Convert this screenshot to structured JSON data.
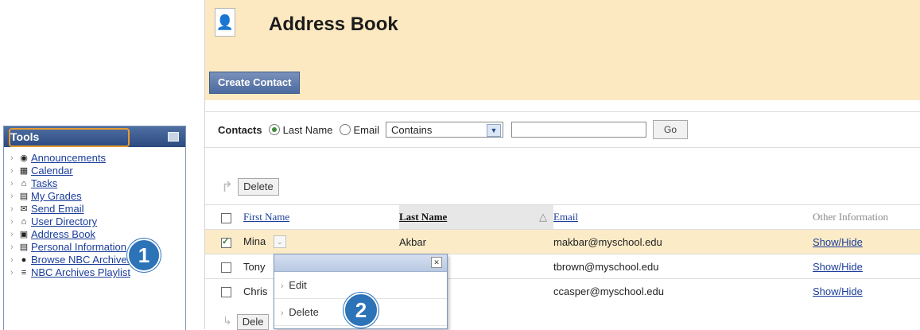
{
  "tools": {
    "title": "Tools",
    "items": [
      {
        "label": "Announcements",
        "icon": "announcements-icon",
        "glyph": "◉"
      },
      {
        "label": "Calendar",
        "icon": "calendar-icon",
        "glyph": "▦"
      },
      {
        "label": "Tasks",
        "icon": "tasks-icon",
        "glyph": "⌂"
      },
      {
        "label": "My Grades",
        "icon": "grades-icon",
        "glyph": "▤"
      },
      {
        "label": "Send Email",
        "icon": "email-icon",
        "glyph": "✉"
      },
      {
        "label": "User Directory",
        "icon": "user-directory-icon",
        "glyph": "⌂"
      },
      {
        "label": "Address Book",
        "icon": "address-book-icon",
        "glyph": "▣"
      },
      {
        "label": "Personal Information",
        "icon": "personal-info-icon",
        "glyph": "▤"
      },
      {
        "label": "Browse NBC Archives",
        "icon": "nbc-archives-icon",
        "glyph": "●"
      },
      {
        "label": "NBC Archives Playlist",
        "icon": "playlist-icon",
        "glyph": "≡"
      }
    ]
  },
  "callouts": {
    "one": "1",
    "two": "2"
  },
  "page": {
    "title": "Address Book",
    "icon": "address-book-page-icon"
  },
  "toolbar": {
    "create_contact": "Create Contact"
  },
  "search": {
    "label": "Contacts",
    "option_lastname": "Last Name",
    "option_email": "Email",
    "operator_selected": "Contains",
    "query": "",
    "go": "Go"
  },
  "actions": {
    "delete": "Delete",
    "delete_bottom": "Dele"
  },
  "table": {
    "headers": {
      "first": "First Name",
      "last": "Last Name",
      "email": "Email",
      "other": "Other Information"
    },
    "rows": [
      {
        "first": "Mina",
        "last": "Akbar",
        "email": "makbar@myschool.edu",
        "other": "Show/Hide",
        "checked": true
      },
      {
        "first": "Tony",
        "last": "",
        "email": "tbrown@myschool.edu",
        "other": "Show/Hide",
        "checked": false
      },
      {
        "first": "Chris",
        "last": "",
        "email": "ccasper@myschool.edu",
        "other": "Show/Hide",
        "checked": false
      }
    ]
  },
  "context_menu": {
    "items": [
      "Edit",
      "Delete"
    ]
  },
  "colors": {
    "accent": "#2c73b8",
    "highlight": "#fce9c2",
    "ring": "#e69b31"
  }
}
